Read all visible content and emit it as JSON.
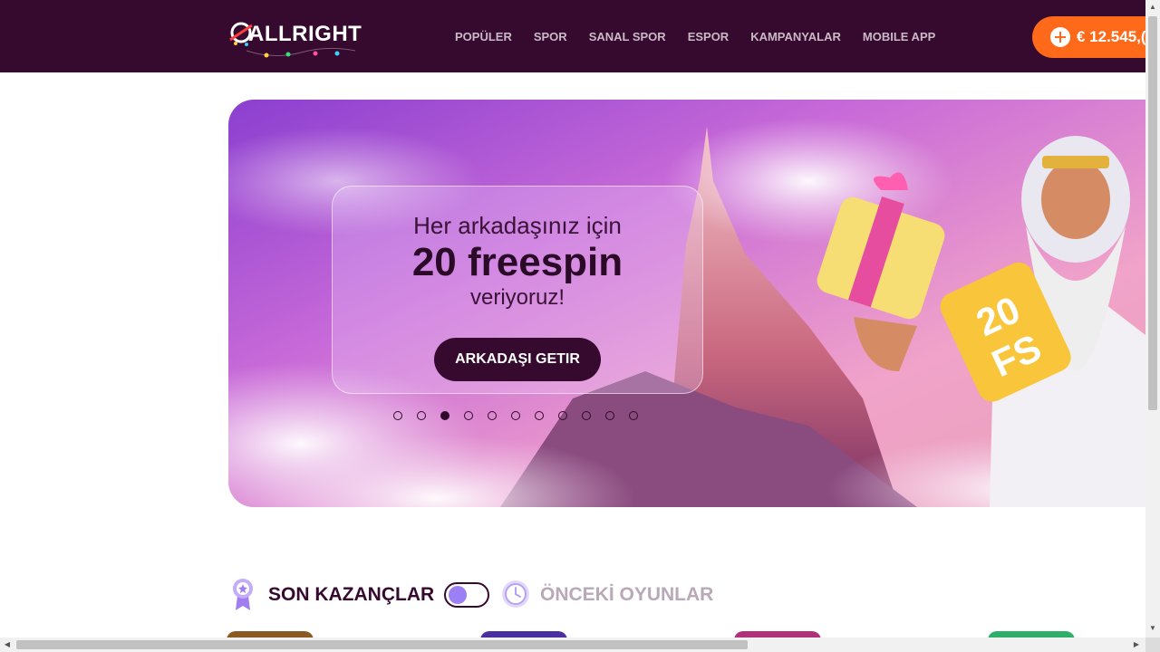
{
  "header": {
    "logo_text": "ALLRIGHT",
    "nav": [
      "POPÜLER",
      "SPOR",
      "SANAL SPOR",
      "ESPOR",
      "KAMPANYALAR",
      "MOBILE APP"
    ],
    "balance": "€ 12.545,("
  },
  "banner": {
    "line1": "Her arkadaşınız için",
    "line2": "20 freespin",
    "line3": "veriyoruz!",
    "cta": "ARKADAŞI GETIR",
    "badge": "20 FS",
    "slides_total": 11,
    "active_slide": 3
  },
  "section": {
    "title": "SON KAZANÇLAR",
    "alt_title": "ÖNCEKİ OYUNLAR",
    "toggle_on": false
  },
  "colors": {
    "header_bg": "#36092f",
    "accent": "#ff6a1a",
    "toggle_knob": "#9d7ff5"
  }
}
